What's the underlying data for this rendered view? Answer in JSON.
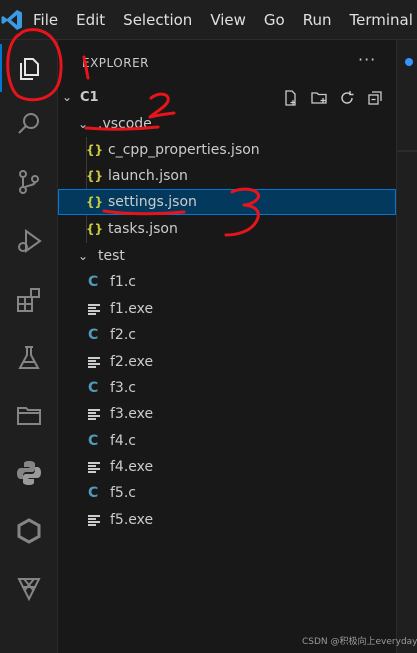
{
  "menu": {
    "items": [
      "File",
      "Edit",
      "Selection",
      "View",
      "Go",
      "Run",
      "Terminal"
    ]
  },
  "activity_bar": {
    "icons": [
      "explorer-icon",
      "search-icon",
      "source-control-icon",
      "run-debug-icon",
      "extensions-icon",
      "testing-icon",
      "folder-icon",
      "python-icon",
      "hexagon-extension-icon",
      "extension-icon"
    ]
  },
  "explorer": {
    "title": "EXPLORER",
    "more": "···",
    "root": "C1",
    "vscode_folder": ".vscode",
    "vscode_files": [
      "c_cpp_properties.json",
      "launch.json",
      "settings.json",
      "tasks.json"
    ],
    "selected_file": "settings.json",
    "test_folder": "test",
    "test_files": [
      "f1.c",
      "f1.exe",
      "f2.c",
      "f2.exe",
      "f3.c",
      "f3.exe",
      "f4.c",
      "f4.exe",
      "f5.c",
      "f5.exe"
    ],
    "toolbar_icons": [
      "new-file-icon",
      "new-folder-icon",
      "refresh-icon",
      "collapse-all-icon"
    ]
  },
  "annotations": {
    "marks": [
      "1",
      "2",
      "3"
    ],
    "color": "#e8141b"
  },
  "colors": {
    "accent": "#0078d4",
    "selection": "#04395e",
    "json_icon": "#cbcb41",
    "c_icon": "#519aba"
  },
  "watermark": "CSDN @积极向上everyday"
}
